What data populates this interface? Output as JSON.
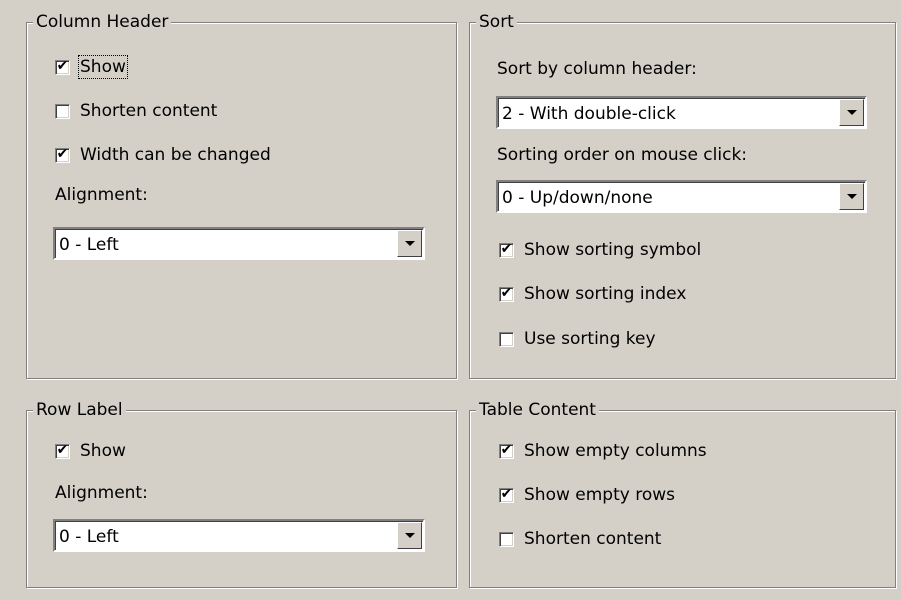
{
  "column_header": {
    "title": "Column Header",
    "show": {
      "label": "Show",
      "checked": true
    },
    "shorten": {
      "label": "Shorten content",
      "checked": false
    },
    "width": {
      "label": "Width can be changed",
      "checked": true
    },
    "alignment_label": "Alignment:",
    "alignment_value": "0 - Left"
  },
  "sort": {
    "title": "Sort",
    "by_header_label": "Sort by column header:",
    "by_header_value": "2 - With double-click",
    "order_label": "Sorting order on mouse click:",
    "order_value": "0 - Up/down/none",
    "symbol": {
      "label": "Show sorting symbol",
      "checked": true
    },
    "index": {
      "label": "Show sorting index",
      "checked": true
    },
    "key": {
      "label": "Use sorting key",
      "checked": false
    }
  },
  "row_label": {
    "title": "Row Label",
    "show": {
      "label": "Show",
      "checked": true
    },
    "alignment_label": "Alignment:",
    "alignment_value": "0 - Left"
  },
  "table_content": {
    "title": "Table Content",
    "empty_columns": {
      "label": "Show empty columns",
      "checked": true
    },
    "empty_rows": {
      "label": "Show empty rows",
      "checked": true
    },
    "shorten": {
      "label": "Shorten content",
      "checked": false
    }
  },
  "check_glyph": "✔"
}
